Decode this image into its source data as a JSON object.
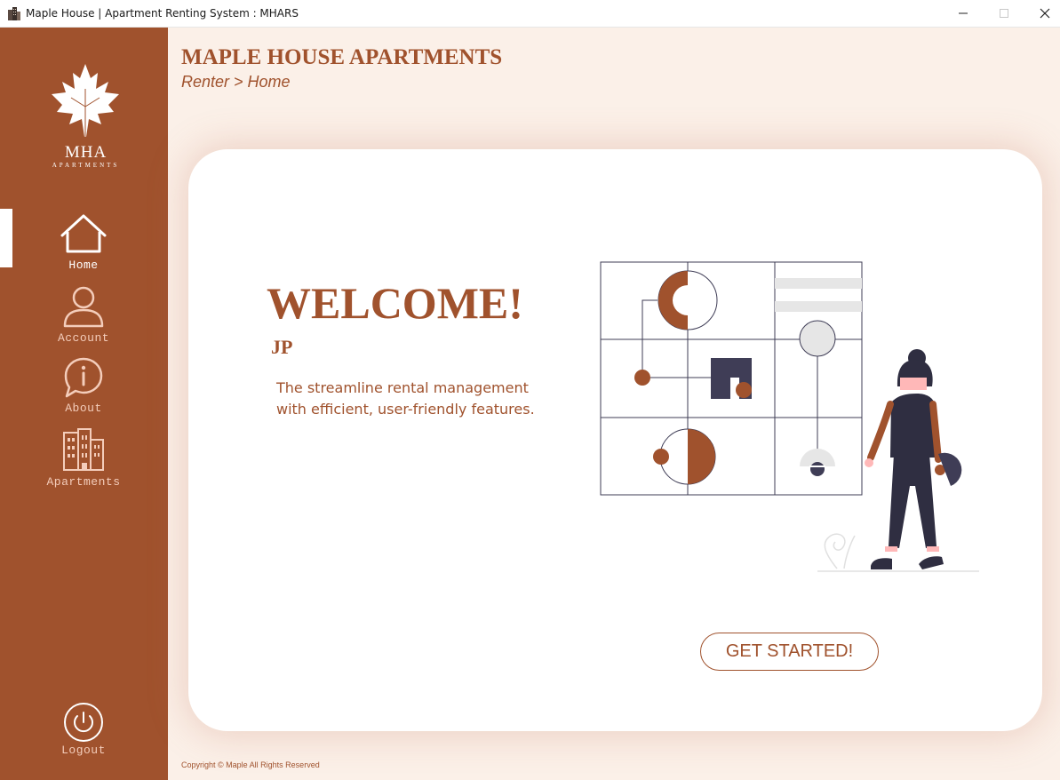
{
  "window": {
    "title": "Maple House | Apartment Renting System : MHARS",
    "app_icon": "building-icon",
    "controls": [
      "minimize-icon",
      "maximize-icon",
      "close-icon"
    ]
  },
  "sidebar": {
    "logo": {
      "icon": "maple-leaf-icon",
      "title": "MHA",
      "subtitle": "APARTMENTS"
    },
    "items": [
      {
        "label": "Home",
        "icon": "home-icon",
        "active": true
      },
      {
        "label": "Account",
        "icon": "user-icon",
        "active": false
      },
      {
        "label": "About",
        "icon": "info-icon",
        "active": false
      },
      {
        "label": "Apartments",
        "icon": "buildings-icon",
        "active": false
      }
    ],
    "logout": {
      "label": "Logout",
      "icon": "power-icon"
    }
  },
  "header": {
    "title": "MAPLE HOUSE APARTMENTS",
    "breadcrumb": "Renter > Home"
  },
  "main": {
    "welcome": "WELCOME!",
    "username": "JP",
    "tagline": "The streamline rental management with efficient, user-friendly features.",
    "illustration": "woman-with-grid-illustration",
    "cta_label": "GET STARTED!"
  },
  "footer": {
    "copyright": "Copyright © Maple All Rights Reserved"
  },
  "colors": {
    "brand": "#a0522d",
    "background": "#fbf0e8",
    "card": "#ffffff",
    "sidebar_text_inactive": "#f4cdbb",
    "dark_figure": "#2f2e41"
  }
}
